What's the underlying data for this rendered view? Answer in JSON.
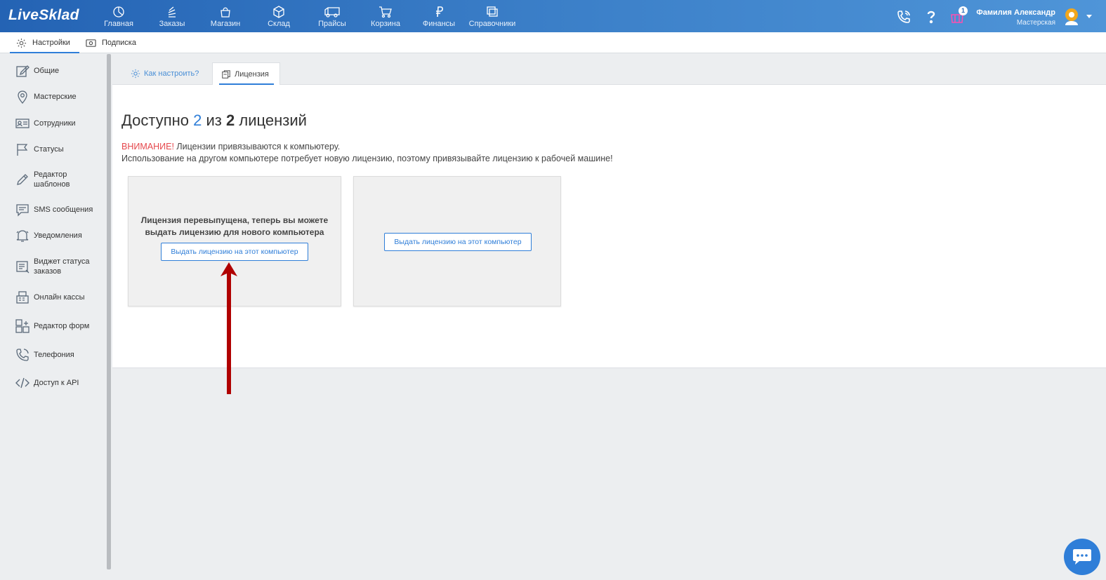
{
  "app": {
    "logo": "LiveSklad"
  },
  "nav": [
    {
      "label": "Главная",
      "icon": "dashboard-icon"
    },
    {
      "label": "Заказы",
      "icon": "orders-icon"
    },
    {
      "label": "Магазин",
      "icon": "shop-bag-icon"
    },
    {
      "label": "Склад",
      "icon": "box-icon"
    },
    {
      "label": "Прайсы",
      "icon": "truck-icon"
    },
    {
      "label": "Корзина",
      "icon": "cart-icon"
    },
    {
      "label": "Финансы",
      "icon": "ruble-icon"
    },
    {
      "label": "Справочники",
      "icon": "books-icon"
    }
  ],
  "header": {
    "notification_count": "1",
    "user_name": "Фамилия Александр",
    "user_role": "Мастерская"
  },
  "subnav": {
    "settings": "Настройки",
    "subscription": "Подписка"
  },
  "sidebar": [
    {
      "label": "Общие",
      "icon": "edit-icon"
    },
    {
      "label": "Мастерские",
      "icon": "location-pin-icon"
    },
    {
      "label": "Сотрудники",
      "icon": "id-card-icon"
    },
    {
      "label": "Статусы",
      "icon": "flag-icon"
    },
    {
      "label": "Редактор шаблонов",
      "icon": "pencil-icon"
    },
    {
      "label": "SMS сообщения",
      "icon": "message-icon"
    },
    {
      "label": "Уведомления",
      "icon": "bell-icon"
    },
    {
      "label": "Виджет статуса заказов",
      "icon": "widget-icon"
    },
    {
      "label": "Онлайн кассы",
      "icon": "cash-register-icon"
    },
    {
      "label": "Редактор форм",
      "icon": "form-editor-icon"
    },
    {
      "label": "Телефония",
      "icon": "phone-icon"
    },
    {
      "label": "Доступ к API",
      "icon": "code-icon"
    }
  ],
  "tabs": {
    "howto": "Как настроить?",
    "license": "Лицензия"
  },
  "license": {
    "title_prefix": "Доступно",
    "available": "2",
    "title_middle": "из",
    "total": "2",
    "title_suffix": "лицензий",
    "warning_label": "ВНИМАНИЕ!",
    "warning_text": "Лицензии привязываются к компьютеру.",
    "warning_line2": "Использование на другом компьютере потребует новую лицензию, поэтому привязывайте лицензию к рабочей машине!",
    "card1_line1": "Лицензия перевыпущена, теперь вы можете",
    "card1_line2": "выдать лицензию для нового компьютера",
    "issue_button": "Выдать лицензию на этот компьютер"
  },
  "colors": {
    "accent": "#2f7ed8",
    "warning": "#e5484d",
    "arrow": "#b00000"
  }
}
